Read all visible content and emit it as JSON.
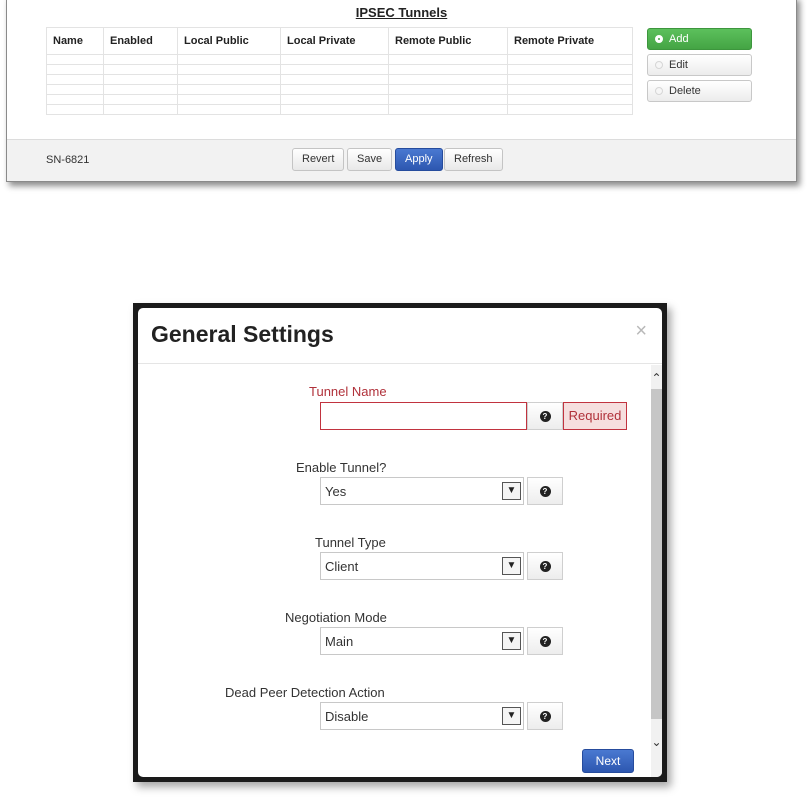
{
  "tunnels_panel": {
    "title": "IPSEC Tunnels",
    "columns": [
      "Name",
      "Enabled",
      "Local Public",
      "Local Private",
      "Remote Public",
      "Remote Private"
    ],
    "empty_rows": 6,
    "buttons": {
      "add": "Add",
      "edit": "Edit",
      "delete": "Delete"
    },
    "footer": {
      "serial": "SN-6821",
      "revert": "Revert",
      "save": "Save",
      "apply": "Apply",
      "refresh": "Refresh"
    }
  },
  "modal": {
    "title": "General Settings",
    "close_glyph": "×",
    "fields": {
      "tunnel_name": {
        "label": "Tunnel Name",
        "value": "",
        "status": "Required"
      },
      "enable_tunnel": {
        "label": "Enable Tunnel?",
        "selected": "Yes"
      },
      "tunnel_type": {
        "label": "Tunnel Type",
        "selected": "Client"
      },
      "negotiation_mode": {
        "label": "Negotiation Mode",
        "selected": "Main"
      },
      "dead_peer_detection": {
        "label": "Dead Peer Detection Action",
        "selected": "Disable"
      }
    },
    "next_button": "Next"
  },
  "colors": {
    "add_button": "#44a444",
    "primary_button": "#2d57b0",
    "error": "#b0313a",
    "modal_frame": "#1a1a1a"
  }
}
